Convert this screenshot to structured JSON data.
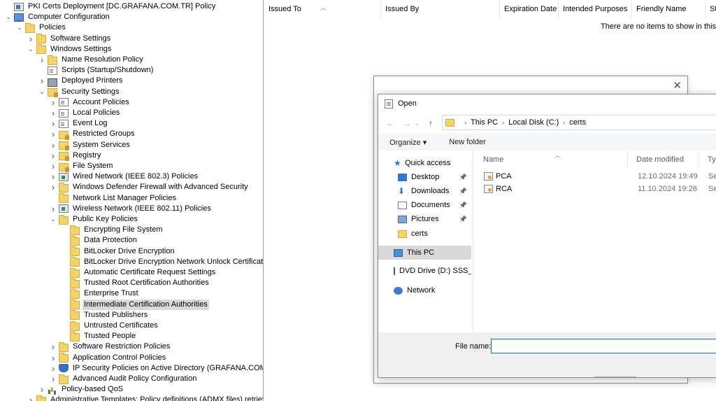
{
  "tree": {
    "items": [
      {
        "label": "PKI Certs Deployment [DC.GRAFANA.COM.TR] Policy",
        "depth": 0,
        "exp": "",
        "icon": "policy"
      },
      {
        "label": "Computer Configuration",
        "depth": 0,
        "exp": "v",
        "icon": "computer"
      },
      {
        "label": "Policies",
        "depth": 1,
        "exp": "v",
        "icon": "folder"
      },
      {
        "label": "Software Settings",
        "depth": 2,
        "exp": ">",
        "icon": "folder"
      },
      {
        "label": "Windows Settings",
        "depth": 2,
        "exp": "v",
        "icon": "folder"
      },
      {
        "label": "Name Resolution Policy",
        "depth": 3,
        "exp": ">",
        "icon": "folder"
      },
      {
        "label": "Scripts (Startup/Shutdown)",
        "depth": 3,
        "exp": "",
        "icon": "doc"
      },
      {
        "label": "Deployed Printers",
        "depth": 3,
        "exp": ">",
        "icon": "printer"
      },
      {
        "label": "Security Settings",
        "depth": 3,
        "exp": "v",
        "icon": "secfolder"
      },
      {
        "label": "Account Policies",
        "depth": 4,
        "exp": ">",
        "icon": "doc"
      },
      {
        "label": "Local Policies",
        "depth": 4,
        "exp": ">",
        "icon": "doc"
      },
      {
        "label": "Event Log",
        "depth": 4,
        "exp": ">",
        "icon": "doc"
      },
      {
        "label": "Restricted Groups",
        "depth": 4,
        "exp": ">",
        "icon": "secfolder"
      },
      {
        "label": "System Services",
        "depth": 4,
        "exp": ">",
        "icon": "secfolder"
      },
      {
        "label": "Registry",
        "depth": 4,
        "exp": ">",
        "icon": "secfolder"
      },
      {
        "label": "File System",
        "depth": 4,
        "exp": ">",
        "icon": "secfolder"
      },
      {
        "label": "Wired Network (IEEE 802.3) Policies",
        "depth": 4,
        "exp": ">",
        "icon": "network"
      },
      {
        "label": "Windows Defender Firewall with Advanced Security",
        "depth": 4,
        "exp": ">",
        "icon": "folder"
      },
      {
        "label": "Network List Manager Policies",
        "depth": 4,
        "exp": "",
        "icon": "folder"
      },
      {
        "label": "Wireless Network (IEEE 802.11) Policies",
        "depth": 4,
        "exp": ">",
        "icon": "network"
      },
      {
        "label": "Public Key Policies",
        "depth": 4,
        "exp": "v",
        "icon": "folder"
      },
      {
        "label": "Encrypting File System",
        "depth": 5,
        "exp": "",
        "icon": "folder"
      },
      {
        "label": "Data Protection",
        "depth": 5,
        "exp": "",
        "icon": "folder"
      },
      {
        "label": "BitLocker Drive Encryption",
        "depth": 5,
        "exp": "",
        "icon": "folder"
      },
      {
        "label": "BitLocker Drive Encryption Network Unlock Certificate",
        "depth": 5,
        "exp": "",
        "icon": "folder"
      },
      {
        "label": "Automatic Certificate Request Settings",
        "depth": 5,
        "exp": "",
        "icon": "folder"
      },
      {
        "label": "Trusted Root Certification Authorities",
        "depth": 5,
        "exp": "",
        "icon": "folder"
      },
      {
        "label": "Enterprise Trust",
        "depth": 5,
        "exp": "",
        "icon": "folder"
      },
      {
        "label": "Intermediate Certification Authorities",
        "depth": 5,
        "exp": "",
        "icon": "folder",
        "selected": true
      },
      {
        "label": "Trusted Publishers",
        "depth": 5,
        "exp": "",
        "icon": "folder"
      },
      {
        "label": "Untrusted Certificates",
        "depth": 5,
        "exp": "",
        "icon": "folder"
      },
      {
        "label": "Trusted People",
        "depth": 5,
        "exp": "",
        "icon": "folder"
      },
      {
        "label": "Software Restriction Policies",
        "depth": 4,
        "exp": ">",
        "icon": "folder"
      },
      {
        "label": "Application Control Policies",
        "depth": 4,
        "exp": ">",
        "icon": "folder"
      },
      {
        "label": "IP Security Policies on Active Directory (GRAFANA.COM.TR)",
        "depth": 4,
        "exp": ">",
        "icon": "shield"
      },
      {
        "label": "Advanced Audit Policy Configuration",
        "depth": 4,
        "exp": ">",
        "icon": "folder"
      },
      {
        "label": "Policy-based QoS",
        "depth": 3,
        "exp": ">",
        "icon": "chart"
      },
      {
        "label": "Administrative Templates: Policy definitions (ADMX files) retrieved fr",
        "depth": 2,
        "exp": ">",
        "icon": "folder"
      }
    ]
  },
  "list": {
    "columns": [
      "Issued To",
      "Issued By",
      "Expiration Date",
      "Intended Purposes",
      "Friendly Name",
      "St"
    ],
    "empty_message": "There are no items to show in this vie"
  },
  "bg_dialog": {
    "close_glyph": "✕"
  },
  "open_dialog": {
    "title": "Open",
    "address": [
      "This PC",
      "Local Disk (C:)",
      "certs"
    ],
    "toolbar": {
      "organize": "Organize ▾",
      "new_folder": "New folder"
    },
    "nav": [
      {
        "label": "Quick access",
        "icon": "star",
        "pin": false
      },
      {
        "label": "Desktop",
        "icon": "desktop",
        "pin": true
      },
      {
        "label": "Downloads",
        "icon": "downloads",
        "pin": true
      },
      {
        "label": "Documents",
        "icon": "documents",
        "pin": true
      },
      {
        "label": "Pictures",
        "icon": "pictures",
        "pin": true
      },
      {
        "label": "certs",
        "icon": "folder",
        "pin": false
      },
      {
        "label": "This PC",
        "icon": "pc",
        "pin": false,
        "selected": true
      },
      {
        "label": "DVD Drive (D:) SSS_X(",
        "icon": "dvd",
        "pin": false
      },
      {
        "label": "Network",
        "icon": "network",
        "pin": false
      }
    ],
    "columns": [
      "Name",
      "Date modified",
      "Typ"
    ],
    "files": [
      {
        "name": "PCA",
        "date": "12.10.2024 19:49",
        "type": "Sec"
      },
      {
        "name": "RCA",
        "date": "11.10.2024 19:26",
        "type": "Sec"
      }
    ],
    "file_name_label": "File name:",
    "file_name_value": ""
  }
}
